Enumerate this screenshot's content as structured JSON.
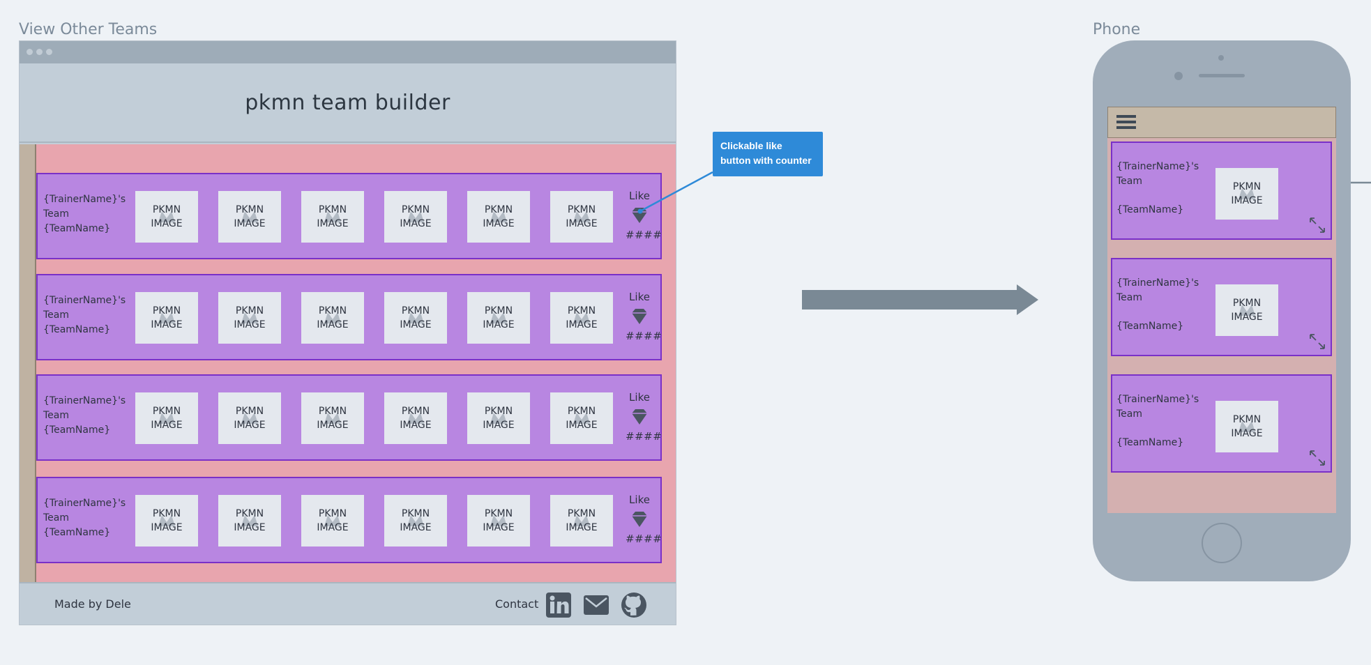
{
  "labels": {
    "desktop_section": "View Other Teams",
    "phone_section": "Phone"
  },
  "app": {
    "title": "pkmn team builder"
  },
  "team_rows": [
    {
      "trainer": "{TrainerName}'s Team",
      "team": "{TeamName}",
      "like_label": "Like",
      "like_count": "####"
    },
    {
      "trainer": "{TrainerName}'s Team",
      "team": "{TeamName}",
      "like_label": "Like",
      "like_count": "####"
    },
    {
      "trainer": "{TrainerName}'s Team",
      "team": "{TeamName}",
      "like_label": "Like",
      "like_count": "####"
    },
    {
      "trainer": "{TrainerName}'s Team",
      "team": "{TeamName}",
      "like_label": "Like",
      "like_count": "####"
    }
  ],
  "pokemon_image_text": [
    "PKMN",
    "IMAGE"
  ],
  "footer": {
    "made_by": "Made by Dele",
    "contact": "Contact",
    "icons": [
      "linkedin-icon",
      "mail-icon",
      "github-icon"
    ]
  },
  "callout": {
    "text": "Clickable like button with counter"
  },
  "mobile": {
    "menu_icon": "hamburger-icon",
    "cards": [
      {
        "trainer": "{TrainerName}'s Team",
        "team": "{TeamName}"
      },
      {
        "trainer": "{TrainerName}'s Team",
        "team": "{TeamName}"
      },
      {
        "trainer": "{TrainerName}'s Team",
        "team": "{TeamName}"
      }
    ]
  },
  "colors": {
    "background": "#eef2f6",
    "chrome": "#c2ced8",
    "content_bg": "#e8a5ae",
    "card_bg": "#b886e1",
    "card_border": "#7a30c8",
    "callout": "#2e8ad8",
    "arrow": "#7a8995",
    "phone_body": "#a0adba"
  }
}
